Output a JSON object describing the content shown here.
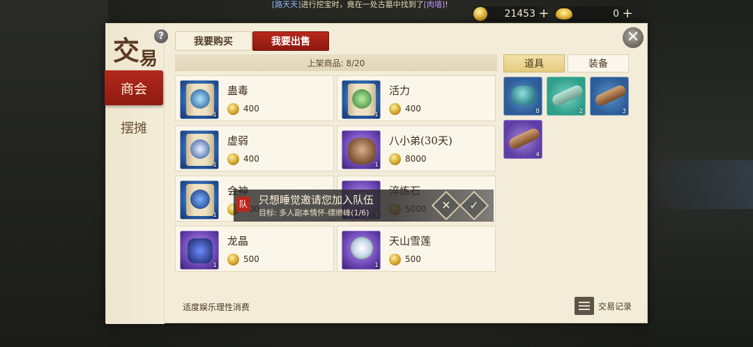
{
  "ticker": {
    "part1": "[路天天]",
    "part2": "进行挖宝时，竟在一处古墓中找到了",
    "part3": "[肉墙]",
    "part4": "!"
  },
  "currency": {
    "gold": "21453",
    "ingot": "0",
    "plus": "+"
  },
  "panel": {
    "logo_char1": "交",
    "logo_char2": "易",
    "help": "?",
    "close": "✕",
    "side_tabs": [
      "商会",
      "摆摊"
    ],
    "top_tabs": {
      "buy": "我要购买",
      "sell": "我要出售"
    },
    "listed_count": "上架商品: 8/20",
    "listings": [
      {
        "name": "蛊毒",
        "price": "400",
        "qty": "1",
        "rarity": "blue"
      },
      {
        "name": "活力",
        "price": "400",
        "qty": "1",
        "rarity": "blue"
      },
      {
        "name": "虚弱",
        "price": "400",
        "qty": "1",
        "rarity": "blue"
      },
      {
        "name": "八小弟(30天)",
        "price": "8000",
        "qty": "1",
        "rarity": "purple"
      },
      {
        "name": "会神",
        "price": "400",
        "qty": "1",
        "rarity": "blue"
      },
      {
        "name": "淬炼石",
        "price": "5000",
        "qty": "1",
        "rarity": "purple"
      },
      {
        "name": "龙晶",
        "price": "500",
        "qty": "1",
        "rarity": "purple"
      },
      {
        "name": "天山雪莲",
        "price": "500",
        "qty": "1",
        "rarity": "purple"
      }
    ],
    "bag_tabs": {
      "items": "道具",
      "equip": "装备"
    },
    "bag_slots": [
      {
        "qty": "8",
        "type": "ore",
        "rarity": "blue"
      },
      {
        "qty": "2",
        "type": "stone-log",
        "rarity": "green"
      },
      {
        "qty": "3",
        "type": "wood-log",
        "rarity": "blue"
      },
      {
        "qty": "4",
        "type": "wood-log",
        "rarity": "purple"
      }
    ],
    "footer_text": "适度娱乐理性消费",
    "record_label": "交易记录"
  },
  "invite": {
    "badge": "队",
    "title": "只想睡觉邀请您加入队伍",
    "subtitle": "目标: 多人副本情怀-缥缈峰(1/6)",
    "reject": "✕",
    "accept": "✓"
  }
}
